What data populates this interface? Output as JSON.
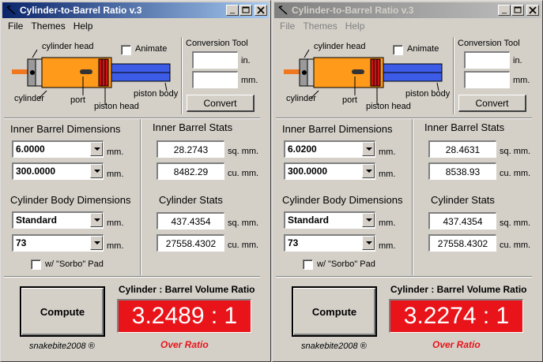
{
  "windows": [
    {
      "title": "Cylinder-to-Barrel Ratio v.3",
      "active": true,
      "menu": [
        "File",
        "Themes",
        "Help"
      ],
      "diagram_labels": {
        "cylinder_head": "cylinder head",
        "cylinder": "cylinder",
        "port": "port",
        "piston_head": "piston head",
        "piston_body": "piston body",
        "animate": "Animate"
      },
      "conversion": {
        "title": "Conversion Tool",
        "in_unit": "in.",
        "mm_unit": "mm.",
        "in_value": "",
        "mm_value": "",
        "convert_label": "Convert"
      },
      "inner_barrel": {
        "title": "Inner Barrel Dimensions",
        "diameter": "6.0000",
        "length": "300.0000",
        "unit": "mm."
      },
      "cylinder_body": {
        "title": "Cylinder Body Dimensions",
        "type": "Standard",
        "length": "73",
        "unit": "mm.",
        "sorbo_label": "w/ \"Sorbo\" Pad"
      },
      "barrel_stats": {
        "title": "Inner Barrel Stats",
        "area": "28.2743",
        "area_unit": "sq. mm.",
        "volume": "8482.29",
        "volume_unit": "cu. mm."
      },
      "cylinder_stats": {
        "title": "Cylinder Stats",
        "area": "437.4354",
        "area_unit": "sq. mm.",
        "volume": "27558.4302",
        "volume_unit": "cu. mm."
      },
      "compute_label": "Compute",
      "credit": "snakebite2008 ®",
      "ratio_title": "Cylinder : Barrel Volume Ratio",
      "ratio": "3.2489 : 1",
      "status": "Over Ratio"
    },
    {
      "title": "Cylinder-to-Barrel Ratio v.3",
      "active": false,
      "menu": [
        "File",
        "Themes",
        "Help"
      ],
      "diagram_labels": {
        "cylinder_head": "cylinder head",
        "cylinder": "cylinder",
        "port": "port",
        "piston_head": "piston head",
        "piston_body": "piston body",
        "animate": "Animate"
      },
      "conversion": {
        "title": "Conversion Tool",
        "in_unit": "in.",
        "mm_unit": "mm.",
        "in_value": "",
        "mm_value": "",
        "convert_label": "Convert"
      },
      "inner_barrel": {
        "title": "Inner Barrel Dimensions",
        "diameter": "6.0200",
        "length": "300.0000",
        "unit": "mm."
      },
      "cylinder_body": {
        "title": "Cylinder Body Dimensions",
        "type": "Standard",
        "length": "73",
        "unit": "mm.",
        "sorbo_label": "w/ \"Sorbo\" Pad"
      },
      "barrel_stats": {
        "title": "Inner Barrel Stats",
        "area": "28.4631",
        "area_unit": "sq. mm.",
        "volume": "8538.93",
        "volume_unit": "cu. mm."
      },
      "cylinder_stats": {
        "title": "Cylinder Stats",
        "area": "437.4354",
        "area_unit": "sq. mm.",
        "volume": "27558.4302",
        "volume_unit": "cu. mm."
      },
      "compute_label": "Compute",
      "credit": "snakebite2008 ®",
      "ratio_title": "Cylinder : Barrel Volume Ratio",
      "ratio": "3.2274 : 1",
      "status": "Over Ratio"
    }
  ],
  "colors": {
    "ratio_bg": "#e8141a",
    "status_text": "#e8141a",
    "cylinder_body": "#ff9a1a",
    "piston_body": "#3c5ce8",
    "piston_head": "#cc1414",
    "nozzle": "#f07820"
  }
}
